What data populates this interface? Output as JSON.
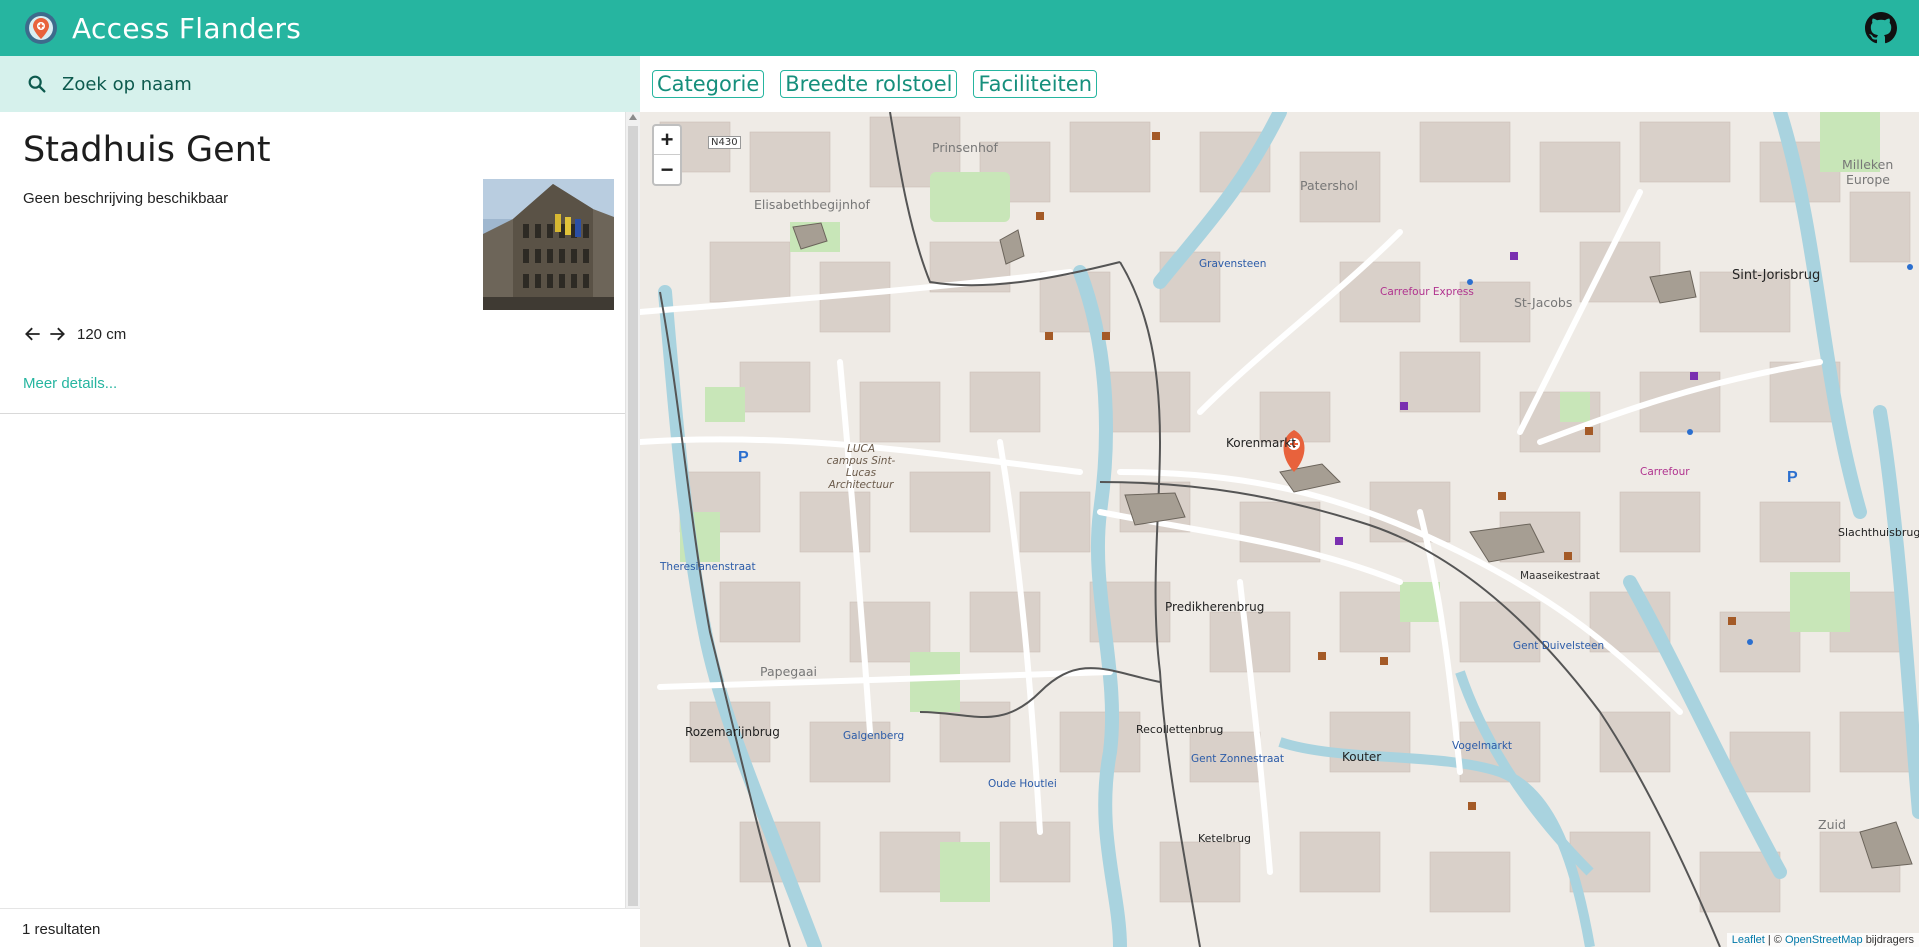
{
  "app": {
    "title": "Access Flanders"
  },
  "search": {
    "placeholder": "Zoek op naam"
  },
  "filters": [
    "Categorie",
    "Breedte rolstoel",
    "Faciliteiten"
  ],
  "result": {
    "name": "Stadhuis Gent",
    "description": "Geen beschrijving beschikbaar",
    "width": "120 cm",
    "more_link": "Meer details..."
  },
  "footer": {
    "count": "1 resultaten"
  },
  "map": {
    "zoom_in": "+",
    "zoom_out": "−",
    "attribution_link": "Leaflet",
    "attribution_sep": "| ©",
    "attribution_osm": "OpenStreetMap",
    "attribution_rest": "bijdragers",
    "labels": {
      "prinsenhof": "Prinsenhof",
      "patershol": "Patershol",
      "elisabethbegijnhof": "Elisabethbegijnhof",
      "milleken": "Milleken",
      "europe": "Europe",
      "sint_jorisbrug": "Sint-Jorisbrug",
      "st_jacobs": "St-Jacobs",
      "korenmarkt": "Korenmarkt",
      "predikherenbrug": "Predikherenbrug",
      "papegaai": "Papegaai",
      "rozemarijnbrug": "Rozemarijnbrug",
      "kouter": "Kouter",
      "zuid": "Zuid",
      "gravensteen": "Gravensteen",
      "gent_duivelsteen": "Gent Duivelsteen",
      "gent_zonnestraat": "Gent Zonnestraat",
      "theresianenstraat": "Theresianenstraat",
      "carrefour_express": "Carrefour Express",
      "carrefour": "Carrefour",
      "luca": "LUCA campus Sint-Lucas Architectuur",
      "slachthuisbrug": "Slachthuisbrug",
      "recollettenbrug": "Recollettenbrug",
      "vogelmarkt": "Vogelmarkt",
      "maaseikestraat": "Maaseikestraat",
      "galgenberg": "Galgenberg",
      "oude_houtlei": "Oude Houtlei",
      "ketelbrug": "Ketelbrug",
      "n430": "N430"
    }
  },
  "colors": {
    "accent": "#26b5a0",
    "search_bg": "#d6f1ec",
    "marker": "#e8623c"
  }
}
